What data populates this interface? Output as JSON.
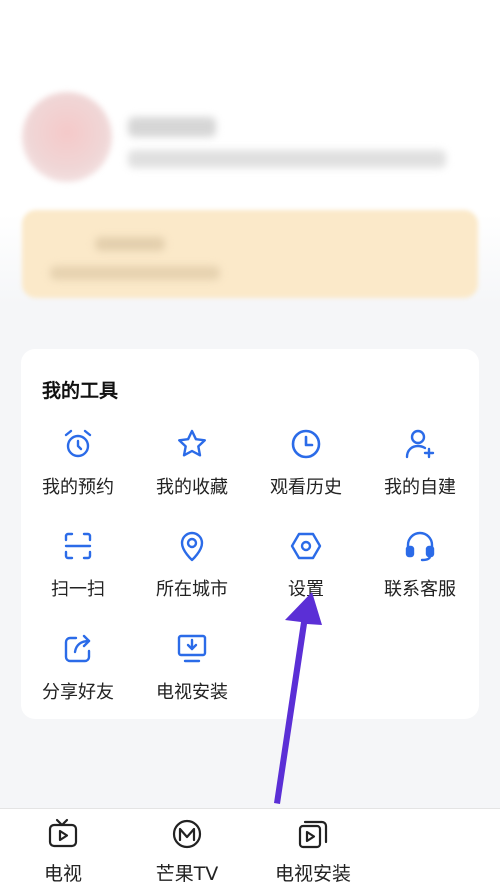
{
  "tools": {
    "title": "我的工具",
    "items": [
      {
        "label": "我的预约",
        "icon": "alarm-clock-icon"
      },
      {
        "label": "我的收藏",
        "icon": "star-icon"
      },
      {
        "label": "观看历史",
        "icon": "clock-icon"
      },
      {
        "label": "我的自建",
        "icon": "add-user-icon"
      },
      {
        "label": "扫一扫",
        "icon": "scan-icon"
      },
      {
        "label": "所在城市",
        "icon": "location-pin-icon"
      },
      {
        "label": "设置",
        "icon": "settings-hexagon-icon"
      },
      {
        "label": "联系客服",
        "icon": "headset-icon"
      },
      {
        "label": "分享好友",
        "icon": "share-icon"
      },
      {
        "label": "电视安装",
        "icon": "tv-download-icon"
      }
    ]
  },
  "tabbar": {
    "items": [
      {
        "label": "电视",
        "icon": "tv-play-icon"
      },
      {
        "label": "芒果TV",
        "icon": "mango-tv-logo-icon"
      },
      {
        "label": "电视安装",
        "icon": "tv-install-icon"
      }
    ]
  },
  "colors": {
    "accent": "#2b6be8",
    "arrow": "#5b2fd6",
    "vip_banner": "#fbe9c9"
  }
}
